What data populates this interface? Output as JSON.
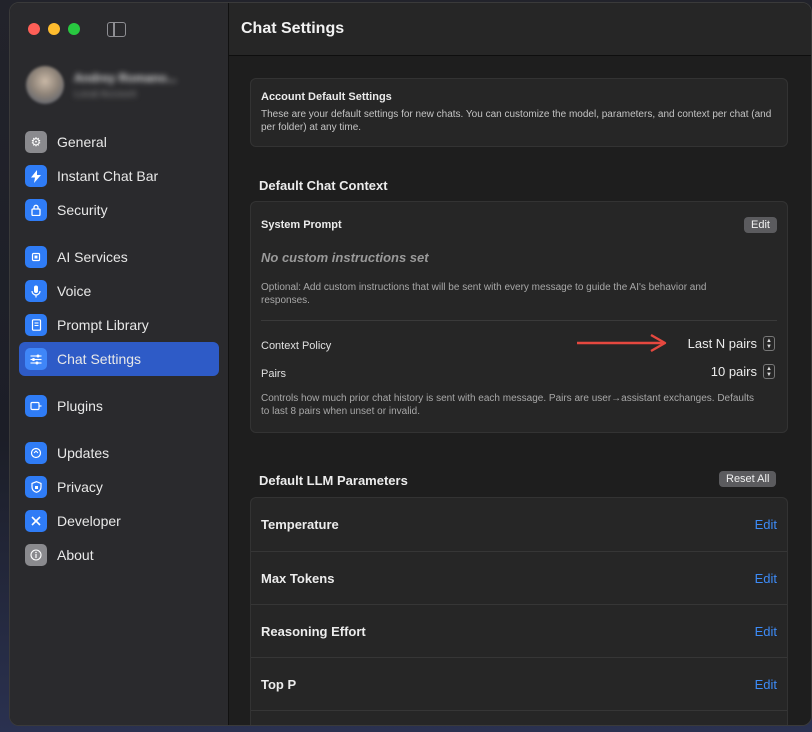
{
  "window": {
    "title": "Chat Settings"
  },
  "profile": {
    "name": "Andrey Romano...",
    "subtitle": "Local Account"
  },
  "sidebar": {
    "groups": [
      [
        {
          "label": "General",
          "icon": "gear-icon"
        },
        {
          "label": "Instant Chat Bar",
          "icon": "bolt-icon"
        },
        {
          "label": "Security",
          "icon": "lock-icon"
        }
      ],
      [
        {
          "label": "AI Services",
          "icon": "chip-icon"
        },
        {
          "label": "Voice",
          "icon": "microphone-icon"
        },
        {
          "label": "Prompt Library",
          "icon": "book-icon"
        },
        {
          "label": "Chat Settings",
          "icon": "sliders-icon",
          "active": true
        }
      ],
      [
        {
          "label": "Plugins",
          "icon": "plug-icon"
        }
      ],
      [
        {
          "label": "Updates",
          "icon": "refresh-icon"
        },
        {
          "label": "Privacy",
          "icon": "shield-icon"
        },
        {
          "label": "Developer",
          "icon": "tools-icon"
        },
        {
          "label": "About",
          "icon": "info-icon"
        }
      ]
    ]
  },
  "account_defaults": {
    "title": "Account Default Settings",
    "description": "These are your default settings for new chats. You can customize the model, parameters, and context per chat (and per folder) at any time."
  },
  "chat_context": {
    "section_title": "Default Chat Context",
    "system_prompt_label": "System Prompt",
    "edit_label": "Edit",
    "no_instructions": "No custom instructions set",
    "optional_text": "Optional: Add custom instructions that will be sent with every message to guide the AI's behavior and responses.",
    "context_policy_label": "Context Policy",
    "context_policy_value": "Last N pairs",
    "pairs_label": "Pairs",
    "pairs_value": "10 pairs",
    "context_desc": "Controls how much prior chat history is sent with each message. Pairs are user→assistant exchanges. Defaults to last 8 pairs when unset or invalid."
  },
  "llm_params": {
    "section_title": "Default LLM Parameters",
    "reset_label": "Reset All",
    "edit_label": "Edit",
    "rows": [
      "Temperature",
      "Max Tokens",
      "Reasoning Effort",
      "Top P"
    ]
  },
  "colors": {
    "accent": "#2e5bc7",
    "link": "#3d8bf7",
    "arrow": "#e5483f"
  }
}
